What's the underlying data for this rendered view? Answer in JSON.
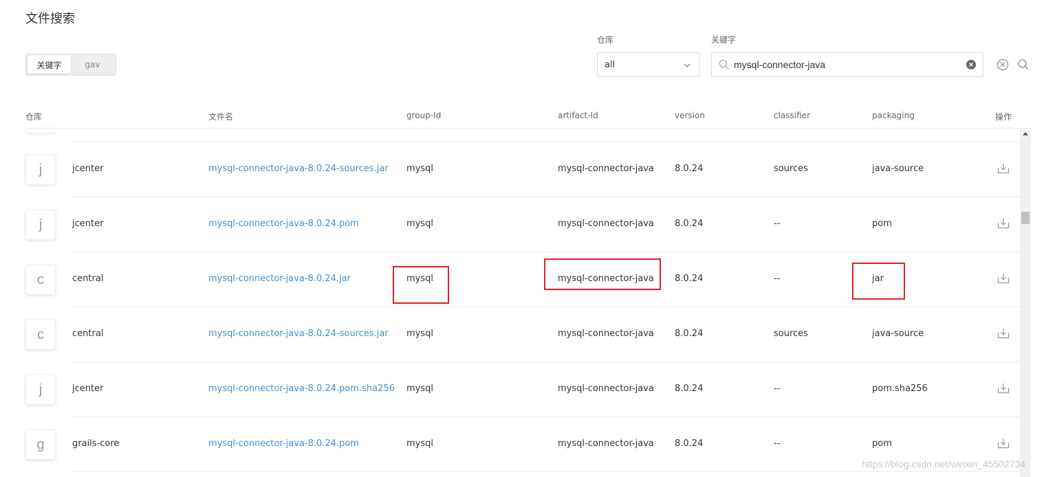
{
  "page": {
    "title": "文件搜索"
  },
  "mode_toggle": {
    "options": [
      "关键字",
      "gav"
    ],
    "active": "关键字"
  },
  "filters": {
    "repo_label": "仓库",
    "repo_value": "all",
    "keyword_label": "关键字",
    "keyword_value": "mysql-connector-java"
  },
  "icons": {
    "chevron": "chevron-down-icon",
    "search": "search-icon",
    "clear": "clear-circle-icon",
    "reset": "reset-circle-icon",
    "download": "download-icon"
  },
  "table": {
    "columns": [
      "仓库",
      "文件名",
      "group-Id",
      "artifact-Id",
      "version",
      "classifier",
      "packaging",
      "操作"
    ],
    "rows": [
      {
        "avatar": "j",
        "repo": "jcenter",
        "filename": "mysql-connector-java-8.0.24-sources.jar",
        "group_id": "mysql",
        "artifact_id": "mysql-connector-java",
        "version": "8.0.24",
        "classifier": "sources",
        "packaging": "java-source"
      },
      {
        "avatar": "j",
        "repo": "jcenter",
        "filename": "mysql-connector-java-8.0.24.pom",
        "group_id": "mysql",
        "artifact_id": "mysql-connector-java",
        "version": "8.0.24",
        "classifier": "--",
        "packaging": "pom"
      },
      {
        "avatar": "c",
        "repo": "central",
        "filename": "mysql-connector-java-8.0.24.jar",
        "group_id": "mysql",
        "artifact_id": "mysql-connector-java",
        "version": "8.0.24",
        "classifier": "--",
        "packaging": "jar"
      },
      {
        "avatar": "c",
        "repo": "central",
        "filename": "mysql-connector-java-8.0.24-sources.jar",
        "group_id": "mysql",
        "artifact_id": "mysql-connector-java",
        "version": "8.0.24",
        "classifier": "sources",
        "packaging": "java-source"
      },
      {
        "avatar": "j",
        "repo": "jcenter",
        "filename": "mysql-connector-java-8.0.24.pom.sha256",
        "group_id": "mysql",
        "artifact_id": "mysql-connector-java",
        "version": "8.0.24",
        "classifier": "--",
        "packaging": "pom.sha256"
      },
      {
        "avatar": "g",
        "repo": "grails-core",
        "filename": "mysql-connector-java-8.0.24.pom",
        "group_id": "mysql",
        "artifact_id": "mysql-connector-java",
        "version": "8.0.24",
        "classifier": "--",
        "packaging": "pom"
      }
    ]
  },
  "annotation_color": "#e02020",
  "link_color": "#3d8fd6",
  "watermark": "https://blog.csdn.net/weixin_45502734"
}
